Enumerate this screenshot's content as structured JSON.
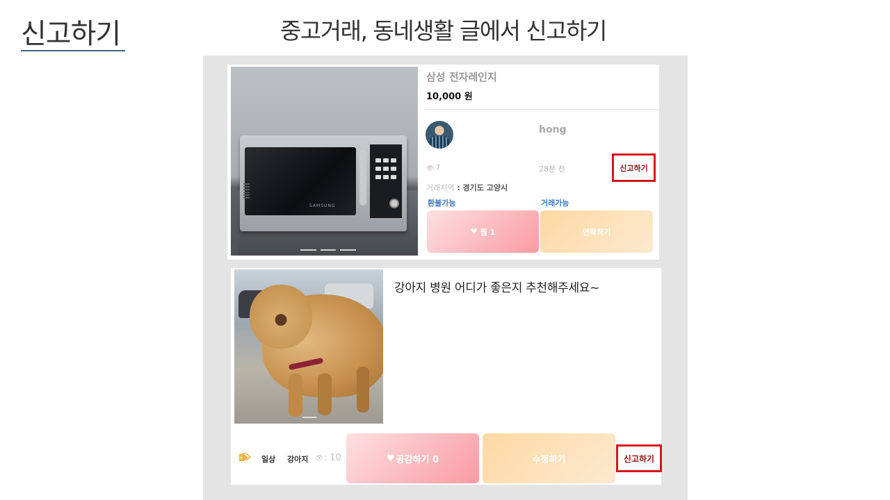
{
  "slide": {
    "title": "신고하기",
    "subtitle": "중고거래, 동네생활 글에서 신고하기"
  },
  "market_post": {
    "product_title": "삼성 전자레인지",
    "price": "10,000 원",
    "photo_brand": "SAMSUNG",
    "seller_name": "hong",
    "views": "7",
    "time_ago": "28분 전",
    "report_label": "신고하기",
    "location_label": "거래지역",
    "location_value": "경기도 고양시",
    "refund_status": "환불가능",
    "trade_status": "거래가능",
    "wish_label": "찜 1",
    "contact_label": "연락하기"
  },
  "community_post": {
    "text": "강아지 병원 어디가 좋은지 추천해주세요~",
    "tags": [
      "일상",
      "강아지"
    ],
    "views": ": 10",
    "empathy_label": "공감하기 0",
    "edit_label": "수정하기",
    "report_label": "신고하기"
  },
  "colors": {
    "report_border": "#d8141a",
    "accent_blue": "#3f78c4",
    "title_underline": "#44607e",
    "panel_bg": "#e5e4e4"
  }
}
